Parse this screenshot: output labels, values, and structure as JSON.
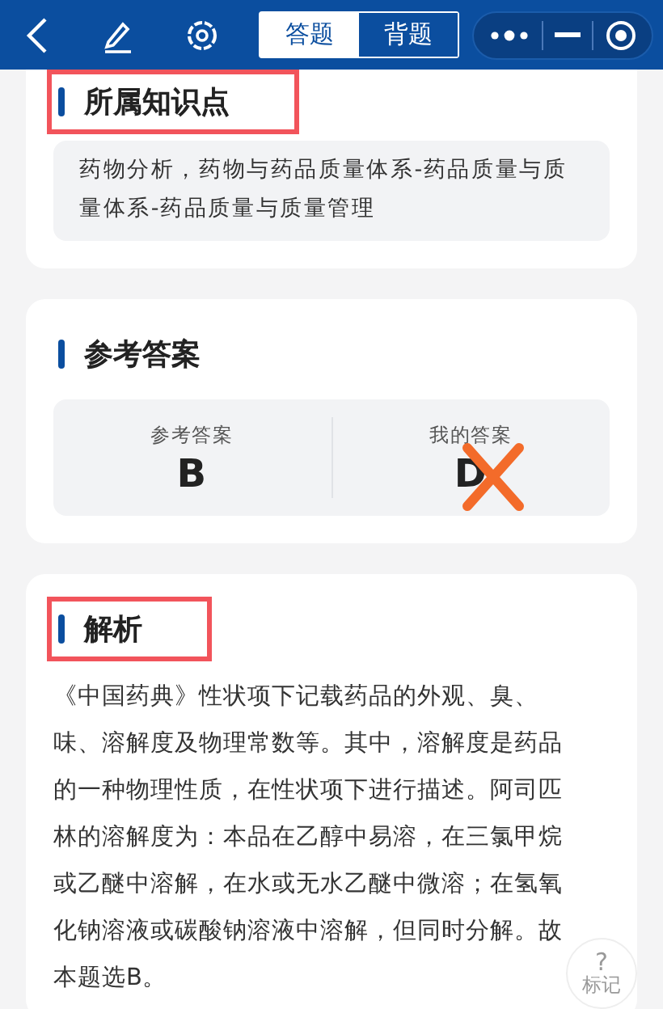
{
  "toolbar": {
    "tabs": [
      {
        "label": "答题",
        "selected": true
      },
      {
        "label": "背题",
        "selected": false
      }
    ]
  },
  "knowledge": {
    "title": "所属知识点",
    "highlighted": true,
    "text": "药物分析，药物与药品质量体系-药品质量与质量体系-药品质量与质量管理"
  },
  "answer": {
    "title": "参考答案",
    "highlighted": false,
    "items": [
      {
        "label": "参考答案",
        "value": "B",
        "wrong": false
      },
      {
        "label": "我的答案",
        "value": "D",
        "wrong": true
      }
    ]
  },
  "analysis": {
    "title": "解析",
    "highlighted": true,
    "text": "《中国药典》性状项下记载药品的外观、臭、味、溶解度及物理常数等。其中，溶解度是药品的一种物理性质，在性状项下进行描述。阿司匹林的溶解度为：本品在乙醇中易溶，在三氯甲烷或乙醚中溶解，在水或无水乙醚中微溶；在氢氧化钠溶液或碳酸钠溶液中溶解，但同时分解。故本题选B。"
  },
  "mark_button": {
    "icon": "?",
    "label": "标记"
  }
}
